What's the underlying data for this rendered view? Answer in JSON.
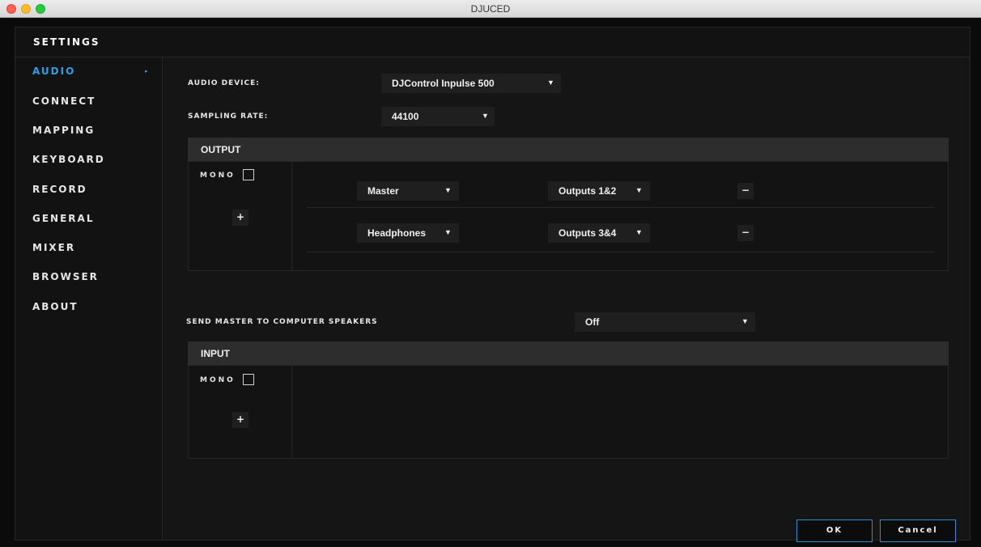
{
  "window": {
    "title": "DJUCED"
  },
  "settings": {
    "title": "SETTINGS"
  },
  "sidebar": {
    "items": [
      {
        "label": "AUDIO"
      },
      {
        "label": "CONNECT"
      },
      {
        "label": "MAPPING"
      },
      {
        "label": "KEYBOARD"
      },
      {
        "label": "RECORD"
      },
      {
        "label": "GENERAL"
      },
      {
        "label": "MIXER"
      },
      {
        "label": "BROWSER"
      },
      {
        "label": "ABOUT"
      }
    ],
    "active": "AUDIO",
    "active_arrow": "▸"
  },
  "audio": {
    "device_label": "AUDIO DEVICE:",
    "device_value": "DJControl Inpulse 500",
    "sampling_label": "SAMPLING RATE:",
    "sampling_value": "44100",
    "caret": "▼"
  },
  "output": {
    "header": "OUTPUT",
    "mono_label": "MONO",
    "mono_checked": false,
    "add_symbol": "+",
    "remove_symbol": "−",
    "rows": [
      {
        "channel": "Master",
        "outputs": "Outputs 1&2"
      },
      {
        "channel": "Headphones",
        "outputs": "Outputs 3&4"
      }
    ]
  },
  "send_master": {
    "label": "SEND MASTER TO COMPUTER SPEAKERS",
    "value": "Off"
  },
  "input": {
    "header": "INPUT",
    "mono_label": "MONO",
    "mono_checked": false,
    "add_symbol": "+"
  },
  "buttons": {
    "ok": "OK",
    "cancel": "Cancel"
  },
  "colors": {
    "accent": "#2aa3e4",
    "background": "#121212",
    "section_header": "#2d2d2d"
  }
}
